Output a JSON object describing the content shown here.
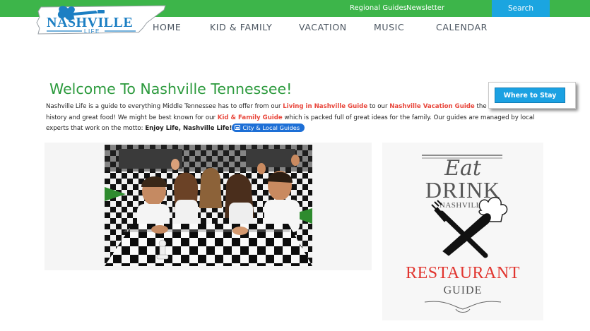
{
  "header": {
    "logo": {
      "name": "NASHVILLE",
      "tagline": "LIFE"
    },
    "util_links": [
      "Regional Guides",
      "Newsletter"
    ],
    "search_label": "Search"
  },
  "nav": [
    "HOME",
    "KID & FAMILY",
    "VACATION",
    "MUSIC",
    "CALENDAR"
  ],
  "main": {
    "title": "Welcome To Nashville Tennessee!",
    "intro": {
      "p1": "Nashville Life is a guide to everything Middle Tennessee has to offer from our ",
      "link1": "Living in Nashville Guide",
      "p2": " to our ",
      "link2": "Nashville Vacation Guide",
      "p3": " the best music, arts, history and great food! We might be best known for our ",
      "link3": "Kid & Family Guide",
      "p4": " which is packed full of great ideas for the family. Our guides are managed by local experts that work on the motto: ",
      "motto": "Enjoy Life, Nashville Life!",
      "pill": "City & Local Guides"
    },
    "where_to_stay": "Where to Stay"
  },
  "restaurant_guide": {
    "eat": "Eat",
    "drink": "DRINK",
    "city": "NASHVILLE",
    "restaurant": "RESTAURANT",
    "guide": "GUIDE"
  },
  "colors": {
    "brand_green": "#3db54a",
    "heading_green": "#2c9a3d",
    "search_blue": "#1ba5e0",
    "link_red": "#e8463b",
    "logo_blue": "#1c7fc3"
  }
}
